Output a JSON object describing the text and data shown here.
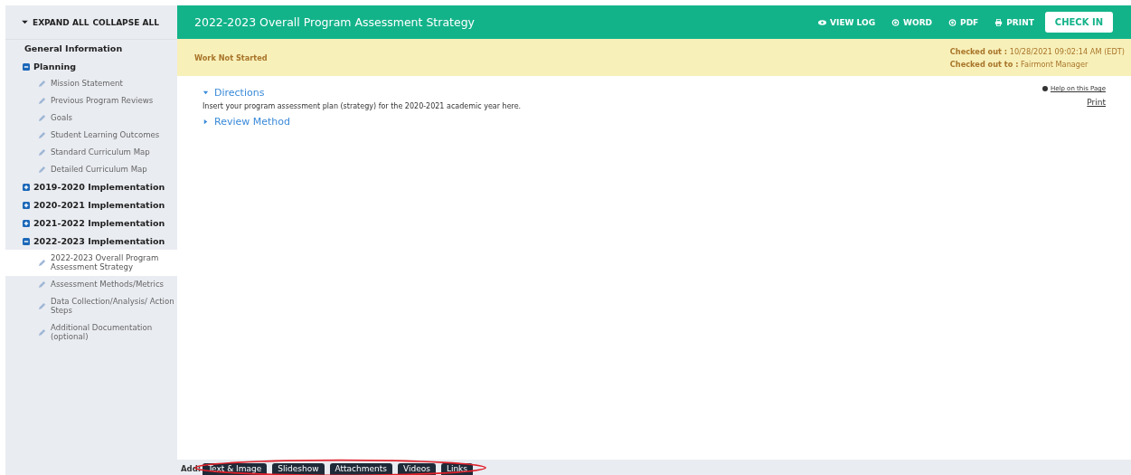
{
  "sidebar": {
    "expand_all": "EXPAND ALL",
    "collapse_all": "COLLAPSE ALL",
    "sections": [
      {
        "label": "General Information",
        "kind": "plain"
      },
      {
        "label": "Planning",
        "kind": "group",
        "expanded": true,
        "children": [
          {
            "label": "Mission Statement",
            "selected": false
          },
          {
            "label": "Previous Program Reviews",
            "selected": false
          },
          {
            "label": "Goals",
            "selected": false
          },
          {
            "label": "Student Learning Outcomes",
            "selected": false
          },
          {
            "label": "Standard Curriculum Map",
            "selected": false
          },
          {
            "label": "Detailed Curriculum Map",
            "selected": false
          }
        ]
      },
      {
        "label": "2019-2020 Implementation",
        "kind": "group",
        "expanded": false
      },
      {
        "label": "2020-2021 Implementation",
        "kind": "group",
        "expanded": false
      },
      {
        "label": "2021-2022 Implementation",
        "kind": "group",
        "expanded": false
      },
      {
        "label": "2022-2023 Implementation",
        "kind": "group",
        "expanded": true,
        "children": [
          {
            "label": "2022-2023 Overall Program Assessment Strategy",
            "selected": true
          },
          {
            "label": "Assessment Methods/Metrics",
            "selected": false
          },
          {
            "label": "Data Collection/Analysis/ Action Steps",
            "selected": false
          },
          {
            "label": "Additional Documentation (optional)",
            "selected": false
          }
        ]
      }
    ]
  },
  "header": {
    "title": "2022-2023 Overall Program Assessment Strategy",
    "actions": [
      {
        "label": "VIEW LOG",
        "kind": "eye"
      },
      {
        "label": "WORD",
        "kind": "circle"
      },
      {
        "label": "PDF",
        "kind": "circle"
      },
      {
        "label": "PRINT",
        "kind": "printer"
      }
    ],
    "check_in": "CHECK IN"
  },
  "status": {
    "state": "Work Not Started",
    "checked_out_label": "Checked out :",
    "checked_out_value": "10/28/2021 09:02:14 AM (EDT)",
    "checked_out_to_label": "Checked out to :",
    "checked_out_to_value": "Fairmont Manager"
  },
  "content": {
    "help_link": "Help on this Page",
    "print_link": "Print",
    "sections": [
      {
        "title": "Directions",
        "expanded": true,
        "body": "Insert your program assessment plan (strategy) for the 2020-2021 academic year here."
      },
      {
        "title": "Review Method",
        "expanded": false
      }
    ]
  },
  "add_bar": {
    "label": "Add:",
    "buttons": [
      "Text & Image",
      "Slideshow",
      "Attachments",
      "Videos",
      "Links"
    ]
  }
}
